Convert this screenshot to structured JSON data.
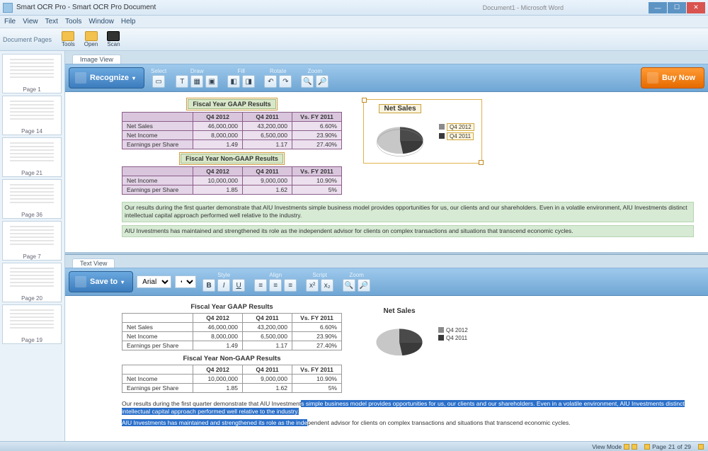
{
  "titlebar": {
    "title": "Smart OCR Pro - Smart OCR Pro Document",
    "bg_doc": "Document1 - Microsoft Word"
  },
  "menu": {
    "items": [
      "File",
      "View",
      "Text",
      "Tools",
      "Window",
      "Help"
    ]
  },
  "quickbar": {
    "label": "Document Pages",
    "btns": [
      {
        "label": "Tools"
      },
      {
        "label": "Open"
      },
      {
        "label": "Scan"
      }
    ]
  },
  "thumbs": {
    "labels": [
      "Page 1",
      "Page 14",
      "Page 21",
      "Page 36",
      "Page 7",
      "Page 20",
      "Page 19"
    ]
  },
  "image_pane": {
    "tab": "Image View",
    "recognize_btn": "Recognize",
    "buy_btn": "Buy Now",
    "groups": {
      "select": "Select",
      "draw": "Draw",
      "fill": "Fill",
      "rotate": "Rotate",
      "zoom": "Zoom"
    }
  },
  "text_pane": {
    "tab": "Text View",
    "save_btn": "Save to",
    "font": "Arial",
    "groups": {
      "style": "Style",
      "align": "Align",
      "script": "Script",
      "zoom": "Zoom"
    }
  },
  "doc": {
    "title_gaap": "Fiscal Year GAAP Results",
    "title_nongaap": "Fiscal Year Non-GAAP Results",
    "headers": [
      "",
      "Q4 2012",
      "Q4 2011",
      "Vs. FY 2011"
    ],
    "gaap_rows": [
      [
        "Net Sales",
        "46,000,000",
        "43,200,000",
        "6.60%"
      ],
      [
        "Net Income",
        "8,000,000",
        "6,500,000",
        "23.90%"
      ],
      [
        "Earnings per Share",
        "1.49",
        "1.17",
        "27.40%"
      ]
    ],
    "nongaap_rows": [
      [
        "Net Income",
        "10,000,000",
        "9,000,000",
        "10.90%"
      ],
      [
        "Earnings per Share",
        "1.85",
        "1.62",
        "5%"
      ]
    ],
    "para1": "Our results during the first quarter demonstrate that AIU Investments simple business model provides opportunities for us, our clients and our shareholders. Even in a volatile environment, AIU Investments distinct intellectual capital approach performed well relative to the industry.",
    "para2": "AIU Investments has maintained and strengthened its role as the independent advisor for clients on complex transactions and situations that transcend economic cycles.",
    "para1_sel_pre": "Our results during the first quarter demonstrate that AIU Investment",
    "para1_sel_hl": "s simple business model provides opportunities for us, our clients and our shareholders. Even in a volatile environment, AIU Investments distinct intellectual capital approach performed well relative to the industry.",
    "para2_sel_hl": "AIU Investments has maintained and strengthened its role as the inde",
    "para2_sel_post": "pendent advisor for clients on complex transactions and situations that transcend economic cycles.",
    "chart_title": "Net Sales",
    "legend": [
      "Q4 2012",
      "Q4 2011"
    ]
  },
  "status": {
    "view": "View Mode",
    "page_label": "Page",
    "page_cur": "21",
    "page_of": "of",
    "page_total": "29"
  },
  "chart_data": {
    "type": "pie",
    "title": "Net Sales",
    "categories": [
      "Q4 2012",
      "Q4 2011"
    ],
    "values": [
      46000000,
      43200000
    ]
  }
}
